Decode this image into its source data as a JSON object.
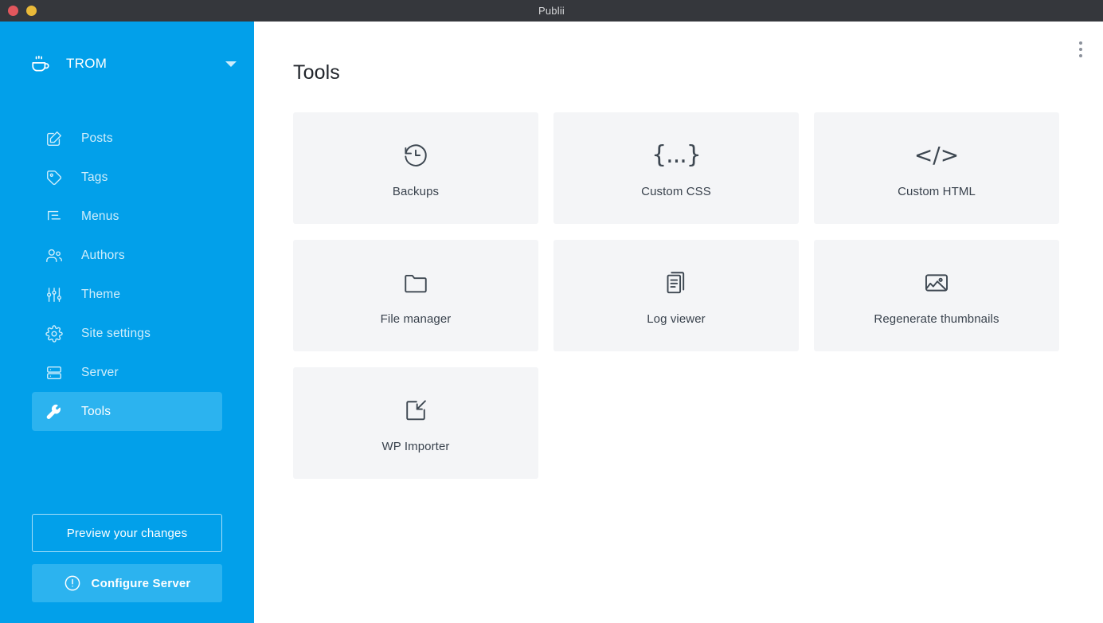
{
  "window": {
    "title": "Publii",
    "controls": [
      {
        "name": "close",
        "color": "#e2575d"
      },
      {
        "name": "minimize",
        "color": "#e9b939"
      }
    ]
  },
  "sidebar": {
    "accent_color": "#02a0ea",
    "active_color": "#2cb3ef",
    "site": {
      "name": "TROM",
      "icon": "coffee-cup-icon",
      "caret": "chevron-down-icon"
    },
    "items": [
      {
        "label": "Posts",
        "icon": "edit-square-icon",
        "active": false
      },
      {
        "label": "Tags",
        "icon": "tag-icon",
        "active": false
      },
      {
        "label": "Menus",
        "icon": "menu-list-icon",
        "active": false
      },
      {
        "label": "Authors",
        "icon": "users-icon",
        "active": false
      },
      {
        "label": "Theme",
        "icon": "sliders-icon",
        "active": false
      },
      {
        "label": "Site settings",
        "icon": "gear-icon",
        "active": false
      },
      {
        "label": "Server",
        "icon": "server-icon",
        "active": false
      },
      {
        "label": "Tools",
        "icon": "wrench-icon",
        "active": true
      }
    ],
    "actions": {
      "preview_label": "Preview your changes",
      "configure_label": "Configure Server",
      "configure_icon": "alert-circle-icon"
    }
  },
  "main": {
    "title": "Tools",
    "overflow_menu": "kebab-menu-icon",
    "tools": [
      {
        "label": "Backups",
        "icon": "history-clock-icon"
      },
      {
        "label": "Custom CSS",
        "icon": "curly-braces-icon",
        "glyph": "{...}"
      },
      {
        "label": "Custom HTML",
        "icon": "code-tags-icon",
        "glyph": "</>"
      },
      {
        "label": "File manager",
        "icon": "folder-icon"
      },
      {
        "label": "Log viewer",
        "icon": "documents-icon"
      },
      {
        "label": "Regenerate thumbnails",
        "icon": "image-icon"
      },
      {
        "label": "WP Importer",
        "icon": "import-box-icon"
      }
    ]
  }
}
